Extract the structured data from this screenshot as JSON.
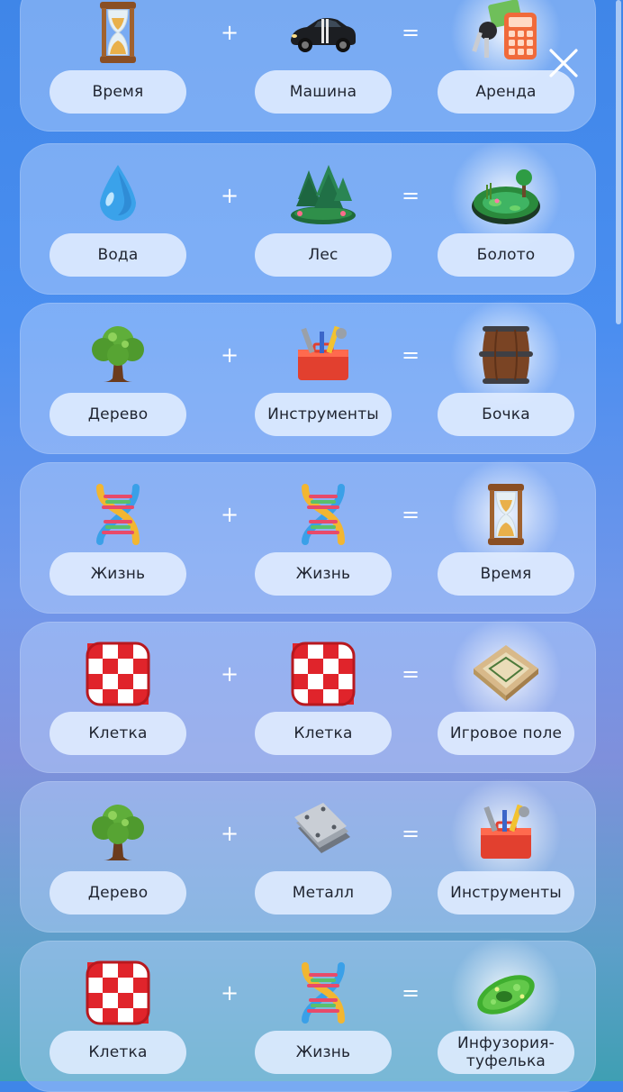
{
  "recipes": [
    {
      "a": {
        "label": "Время",
        "icon": "hourglass-icon"
      },
      "b": {
        "label": "Машина",
        "icon": "car-icon"
      },
      "result": {
        "label": "Аренда",
        "icon": "car-keys-calculator-icon"
      }
    },
    {
      "a": {
        "label": "Вода",
        "icon": "water-drop-icon"
      },
      "b": {
        "label": "Лес",
        "icon": "forest-icon"
      },
      "result": {
        "label": "Болото",
        "icon": "swamp-icon"
      }
    },
    {
      "a": {
        "label": "Дерево",
        "icon": "tree-icon"
      },
      "b": {
        "label": "Инструменты",
        "icon": "toolbox-icon"
      },
      "result": {
        "label": "Бочка",
        "icon": "barrel-icon"
      }
    },
    {
      "a": {
        "label": "Жизнь",
        "icon": "dna-icon"
      },
      "b": {
        "label": "Жизнь",
        "icon": "dna-icon"
      },
      "result": {
        "label": "Время",
        "icon": "hourglass-icon"
      }
    },
    {
      "a": {
        "label": "Клетка",
        "icon": "checkered-cloth-icon"
      },
      "b": {
        "label": "Клетка",
        "icon": "checkered-cloth-icon"
      },
      "result": {
        "label": "Игровое поле",
        "icon": "game-board-icon"
      }
    },
    {
      "a": {
        "label": "Дерево",
        "icon": "tree-icon"
      },
      "b": {
        "label": "Металл",
        "icon": "metal-plates-icon"
      },
      "result": {
        "label": "Инструменты",
        "icon": "toolbox-icon"
      }
    },
    {
      "a": {
        "label": "Клетка",
        "icon": "checkered-cloth-icon"
      },
      "b": {
        "label": "Жизнь",
        "icon": "dna-icon"
      },
      "result": {
        "label": "Инфузория-туфелька",
        "icon": "paramecium-icon"
      }
    }
  ],
  "operators": {
    "plus": "+",
    "equals": "="
  },
  "close": {
    "icon": "close-icon"
  },
  "colors": {
    "card": "#b4cffc",
    "pill": "#e1edff",
    "text": "#1f2430",
    "operator": "#ffffff"
  }
}
